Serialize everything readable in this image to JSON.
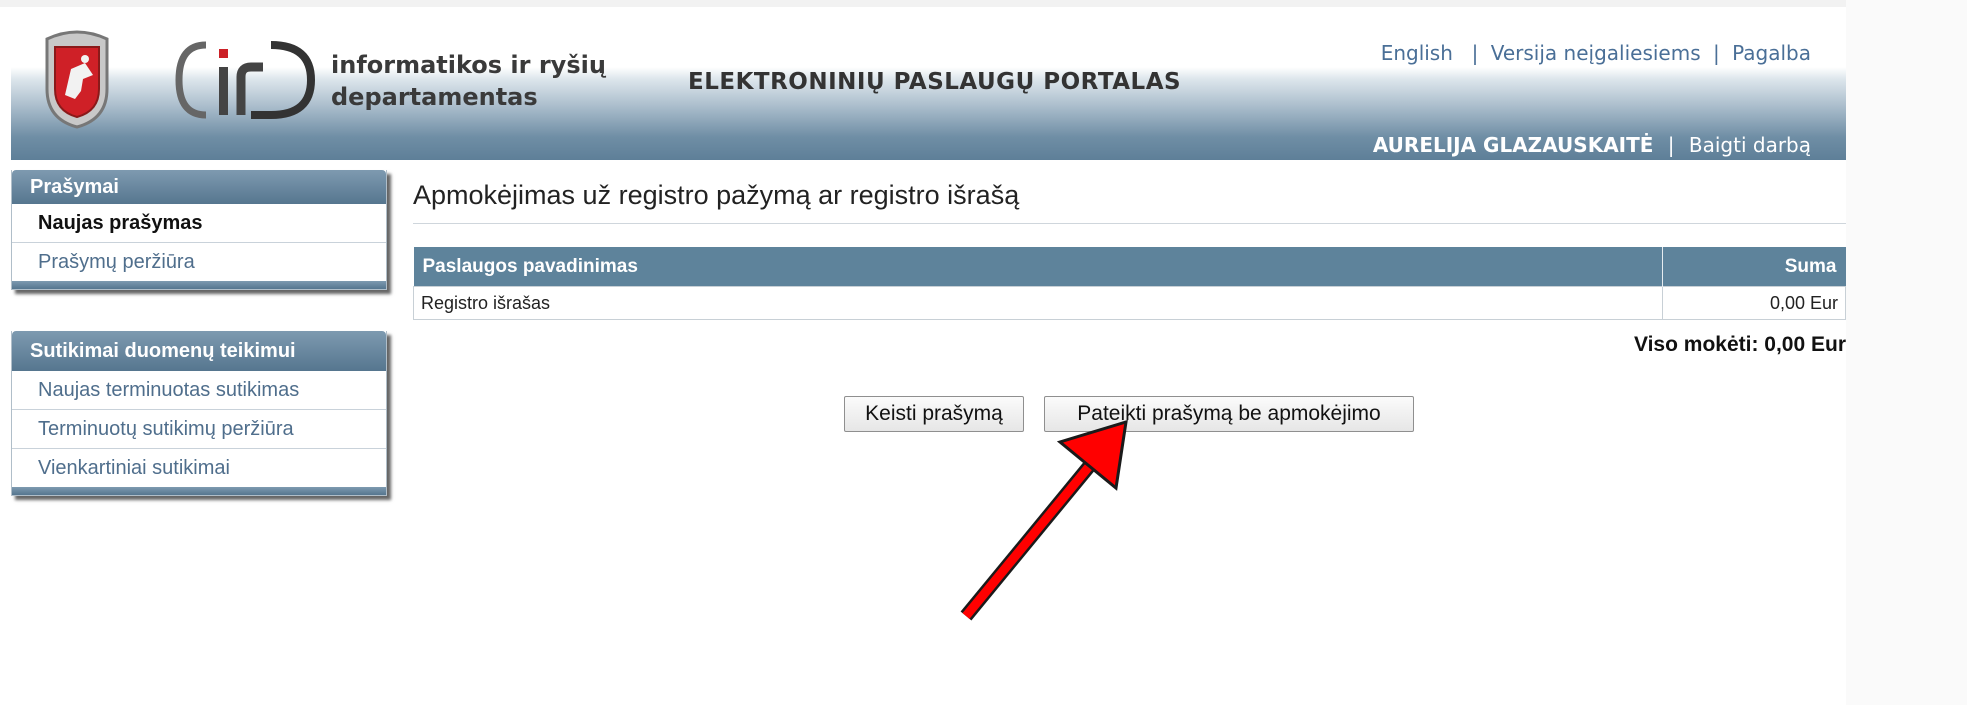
{
  "header": {
    "org_line1": "informatikos ir ryšių",
    "org_line2": "departamentas",
    "portal_title": "ELEKTRONINIŲ PASLAUGŲ PORTALAS",
    "links": {
      "english": "English",
      "accessible": "Versija neįgaliesiems",
      "help": "Pagalba"
    },
    "user_name": "AURELIJA GLAZAUSKAITĖ",
    "logout": "Baigti darbą"
  },
  "sidebar": {
    "requests": {
      "title": "Prašymai",
      "items": [
        {
          "label": "Naujas prašymas",
          "active": true
        },
        {
          "label": "Prašymų peržiūra",
          "active": false
        }
      ]
    },
    "consents": {
      "title": "Sutikimai duomenų teikimui",
      "items": [
        {
          "label": "Naujas terminuotas sutikimas"
        },
        {
          "label": "Terminuotų sutikimų peržiūra"
        },
        {
          "label": "Vienkartiniai sutikimai"
        }
      ]
    }
  },
  "main": {
    "title": "Apmokėjimas už registro pažymą ar registro išrašą",
    "table": {
      "col_name": "Paslaugos pavadinimas",
      "col_sum": "Suma",
      "rows": [
        {
          "name": "Registro išrašas",
          "sum": "0,00 Eur"
        }
      ]
    },
    "total": "Viso mokėti:  0,00 Eur",
    "buttons": {
      "change": "Keisti prašymą",
      "submit": "Pateikti prašymą be apmokėjimo"
    }
  },
  "colors": {
    "header_blue": "#5e7f98",
    "menu_head": "#56768f",
    "table_head": "#5e839b",
    "link": "#4a6f97",
    "arrow": "#ff0000"
  }
}
